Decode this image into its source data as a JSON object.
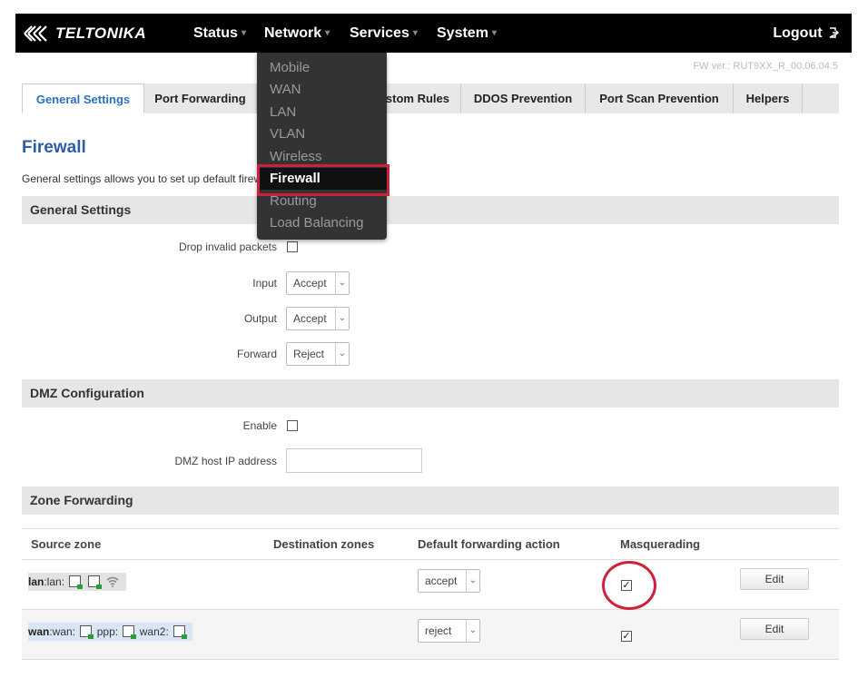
{
  "brand": {
    "logo_text": "TELTONIKA"
  },
  "nav": {
    "items": [
      {
        "label": "Status"
      },
      {
        "label": "Network"
      },
      {
        "label": "Services"
      },
      {
        "label": "System"
      }
    ],
    "logout_label": "Logout"
  },
  "fw_version": "FW ver.: RUT9XX_R_00.06.04.5",
  "network_menu": {
    "items": [
      "Mobile",
      "WAN",
      "LAN",
      "VLAN",
      "Wireless",
      "Firewall",
      "Routing",
      "Load Balancing"
    ],
    "selected": "Firewall"
  },
  "tabs": [
    {
      "label": "General Settings",
      "active": true
    },
    {
      "label": "Port Forwarding"
    },
    {
      "label": "Custom Rules"
    },
    {
      "label": "DDOS Prevention"
    },
    {
      "label": "Port Scan Prevention"
    },
    {
      "label": "Helpers"
    }
  ],
  "page": {
    "title": "Firewall",
    "description": "General settings allows you to set up default firewall policy."
  },
  "general": {
    "title": "General Settings",
    "drop_invalid_label": "Drop invalid packets",
    "input_label": "Input",
    "input_value": "Accept",
    "output_label": "Output",
    "output_value": "Accept",
    "forward_label": "Forward",
    "forward_value": "Reject"
  },
  "dmz": {
    "title": "DMZ Configuration",
    "enable_label": "Enable",
    "host_label": "DMZ host IP address",
    "host_value": ""
  },
  "zone_forwarding": {
    "title": "Zone Forwarding",
    "headers": {
      "source": "Source zone",
      "destination": "Destination zones",
      "action": "Default forwarding action",
      "masq": "Masquerading"
    },
    "rows": [
      {
        "zone": "lan",
        "desc1": ":lan:",
        "action": "accept",
        "masquerading": true,
        "edit": "Edit"
      },
      {
        "zone": "wan",
        "desc1": ":wan:",
        "desc2": "ppp:",
        "desc3": "wan2:",
        "action": "reject",
        "masquerading": true,
        "edit": "Edit"
      }
    ]
  },
  "colors": {
    "accent": "#2a70c0",
    "highlight": "#d0213a",
    "navbar": "#000000"
  }
}
